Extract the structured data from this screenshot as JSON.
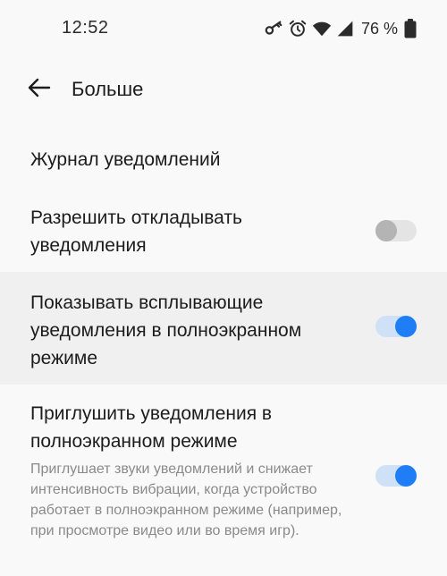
{
  "status_bar": {
    "time": "12:52",
    "battery_text": "76 %",
    "icons": [
      "key-icon",
      "alarm-icon",
      "wifi-icon",
      "cellular-signal-icon",
      "battery-icon"
    ]
  },
  "header": {
    "back_icon": "arrow-left-icon",
    "title": "Больше"
  },
  "settings": [
    {
      "title": "Журнал уведомлений"
    },
    {
      "title": "Разрешить откладывать уведомления",
      "toggle_on": false
    },
    {
      "title": "Показывать всплывающие уведомления в полноэкранном режиме",
      "toggle_on": true
    },
    {
      "title": "Приглушить уведомления в полноэкранном режиме",
      "description": "Приглушает звуки уведомлений и снижает интенсивность вибрации, когда устройство работает в полноэкранном режиме (например, при просмотре видео или во время игр).",
      "toggle_on": true
    }
  ],
  "colors": {
    "background": "#f9f9f9",
    "highlight_row": "#f0f0f0",
    "accent": "#1f7ef5",
    "accent_track": "#cfe1f7",
    "off_thumb": "#b4b4b4",
    "off_track": "#e4e4e4",
    "secondary_text": "#8a8a8a"
  }
}
